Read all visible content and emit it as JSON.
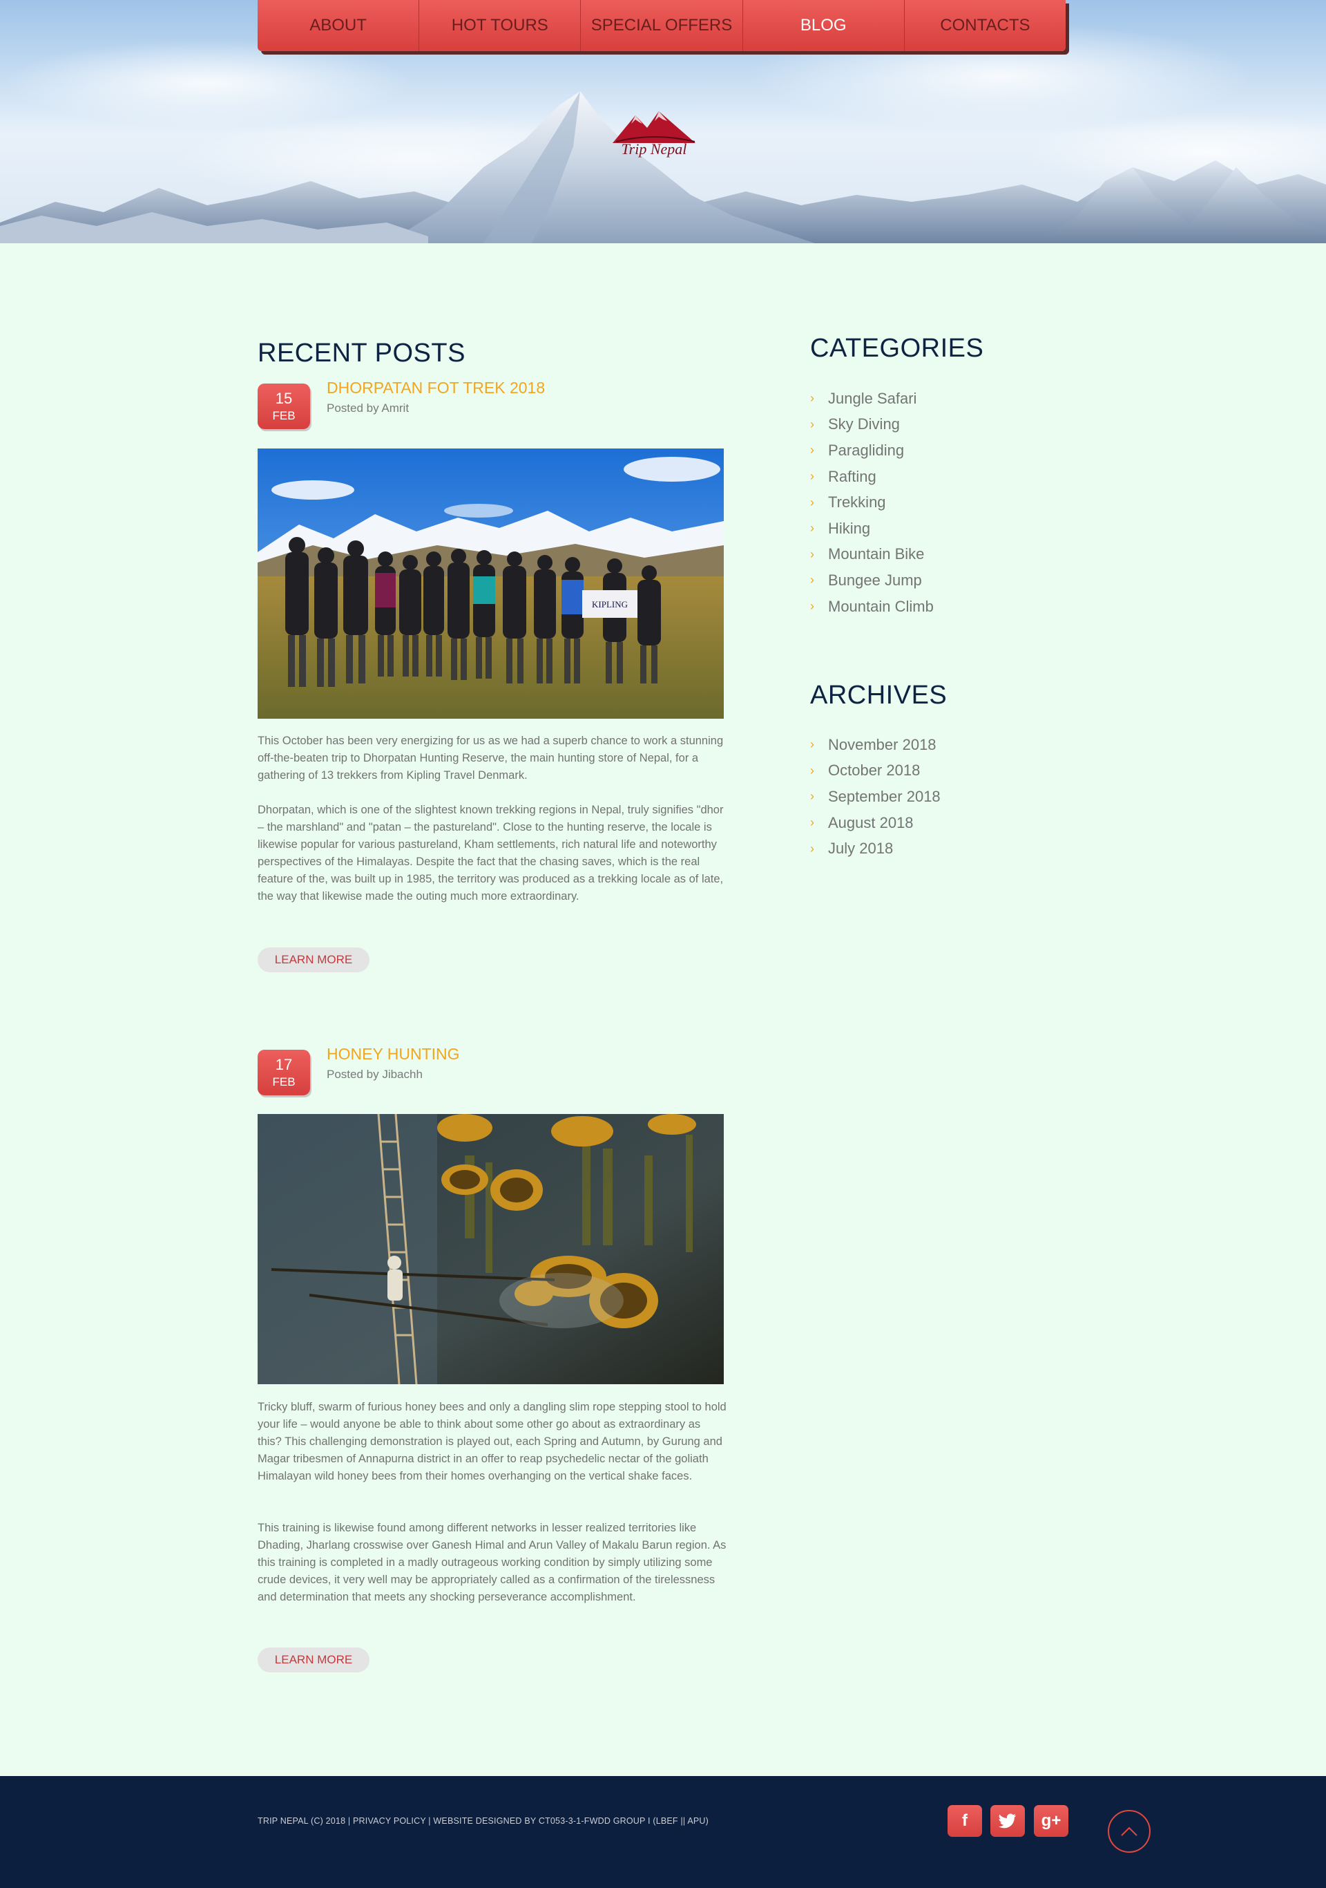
{
  "nav": {
    "items": [
      {
        "label": "ABOUT"
      },
      {
        "label": "HOT TOURS"
      },
      {
        "label": "SPECIAL OFFERS"
      },
      {
        "label": "BLOG"
      },
      {
        "label": "CONTACTS"
      }
    ],
    "active": "BLOG"
  },
  "brand": {
    "logo_text": "Trip Nepal",
    "colors": {
      "accent": "#d94442",
      "title": "#0e2341",
      "post_title": "#f3a51d",
      "background": "#eafdf0",
      "footer": "#0d1f3e"
    }
  },
  "recent_posts": {
    "title": "RECENT POSTS",
    "posts": [
      {
        "day": "15",
        "month": "FEB",
        "title": "DHORPATAN FOT TREK 2018",
        "meta": "Posted by Amrit",
        "paragraphs": [
          "This October has been very energizing for us as we had a superb chance to work a stunning off-the-beaten trip to Dhorpatan Hunting Reserve, the main hunting store of Nepal, for a gathering of 13 trekkers from Kipling Travel Denmark.",
          "Dhorpatan, which is one of the slightest known trekking regions in Nepal, truly signifies \"dhor – the marshland\" and \"patan – the pastureland\". Close to the hunting reserve, the locale is likewise popular for various pastureland, Kham settlements, rich natural life and noteworthy perspectives of the Himalayas. Despite the fact that the chasing saves, which is the real feature of the, was built up in 1985, the territory was produced as a trekking locale as of late, the way that likewise made the outing much more extraordinary."
        ],
        "button": "LEARN MORE",
        "banner_text": "KIPLING"
      },
      {
        "day": "17",
        "month": "FEB",
        "title": "HONEY HUNTING",
        "meta": "Posted by Jibachh",
        "paragraphs": [
          "Tricky bluff, swarm of furious honey bees and only a dangling slim rope stepping stool to hold your life – would anyone be able to think about some other go about as extraordinary as this? This challenging demonstration is played out, each Spring and Autumn, by Gurung and Magar tribesmen of Annapurna district in an offer to reap psychedelic nectar of the goliath Himalayan wild honey bees from their homes overhanging on the vertical shake faces.",
          "This training is likewise found among different networks in lesser realized territories like Dhading, Jharlang crosswise over Ganesh Himal and Arun Valley of Makalu Barun region. As this training is completed in a madly outrageous working condition by simply utilizing some crude devices, it very well may be appropriately called as a confirmation of the tirelessness and determination that meets any shocking perseverance accomplishment."
        ],
        "button": "LEARN MORE"
      }
    ]
  },
  "categories": {
    "title": "CATEGORIES",
    "items": [
      "Jungle Safari",
      "Sky Diving",
      "Paragliding",
      "Rafting",
      "Trekking",
      "Hiking",
      "Mountain Bike",
      "Bungee Jump",
      "Mountain Climb"
    ]
  },
  "archives": {
    "title": "ARCHIVES",
    "items": [
      "November 2018",
      "October 2018",
      "September 2018",
      "August 2018",
      "July 2018"
    ]
  },
  "footer": {
    "copyright": "TRIP NEPAL (C) 2018 | PRIVACY POLICY | WEBSITE DESIGNED BY CT053-3-1-FWDD GROUP I (LBEF || APU)",
    "social": [
      {
        "icon": "facebook-icon",
        "glyph": "f"
      },
      {
        "icon": "twitter-icon",
        "glyph": "t"
      },
      {
        "icon": "google-plus-icon",
        "glyph": "g+"
      }
    ],
    "back_to_top_icon": "chevron-up-icon"
  }
}
